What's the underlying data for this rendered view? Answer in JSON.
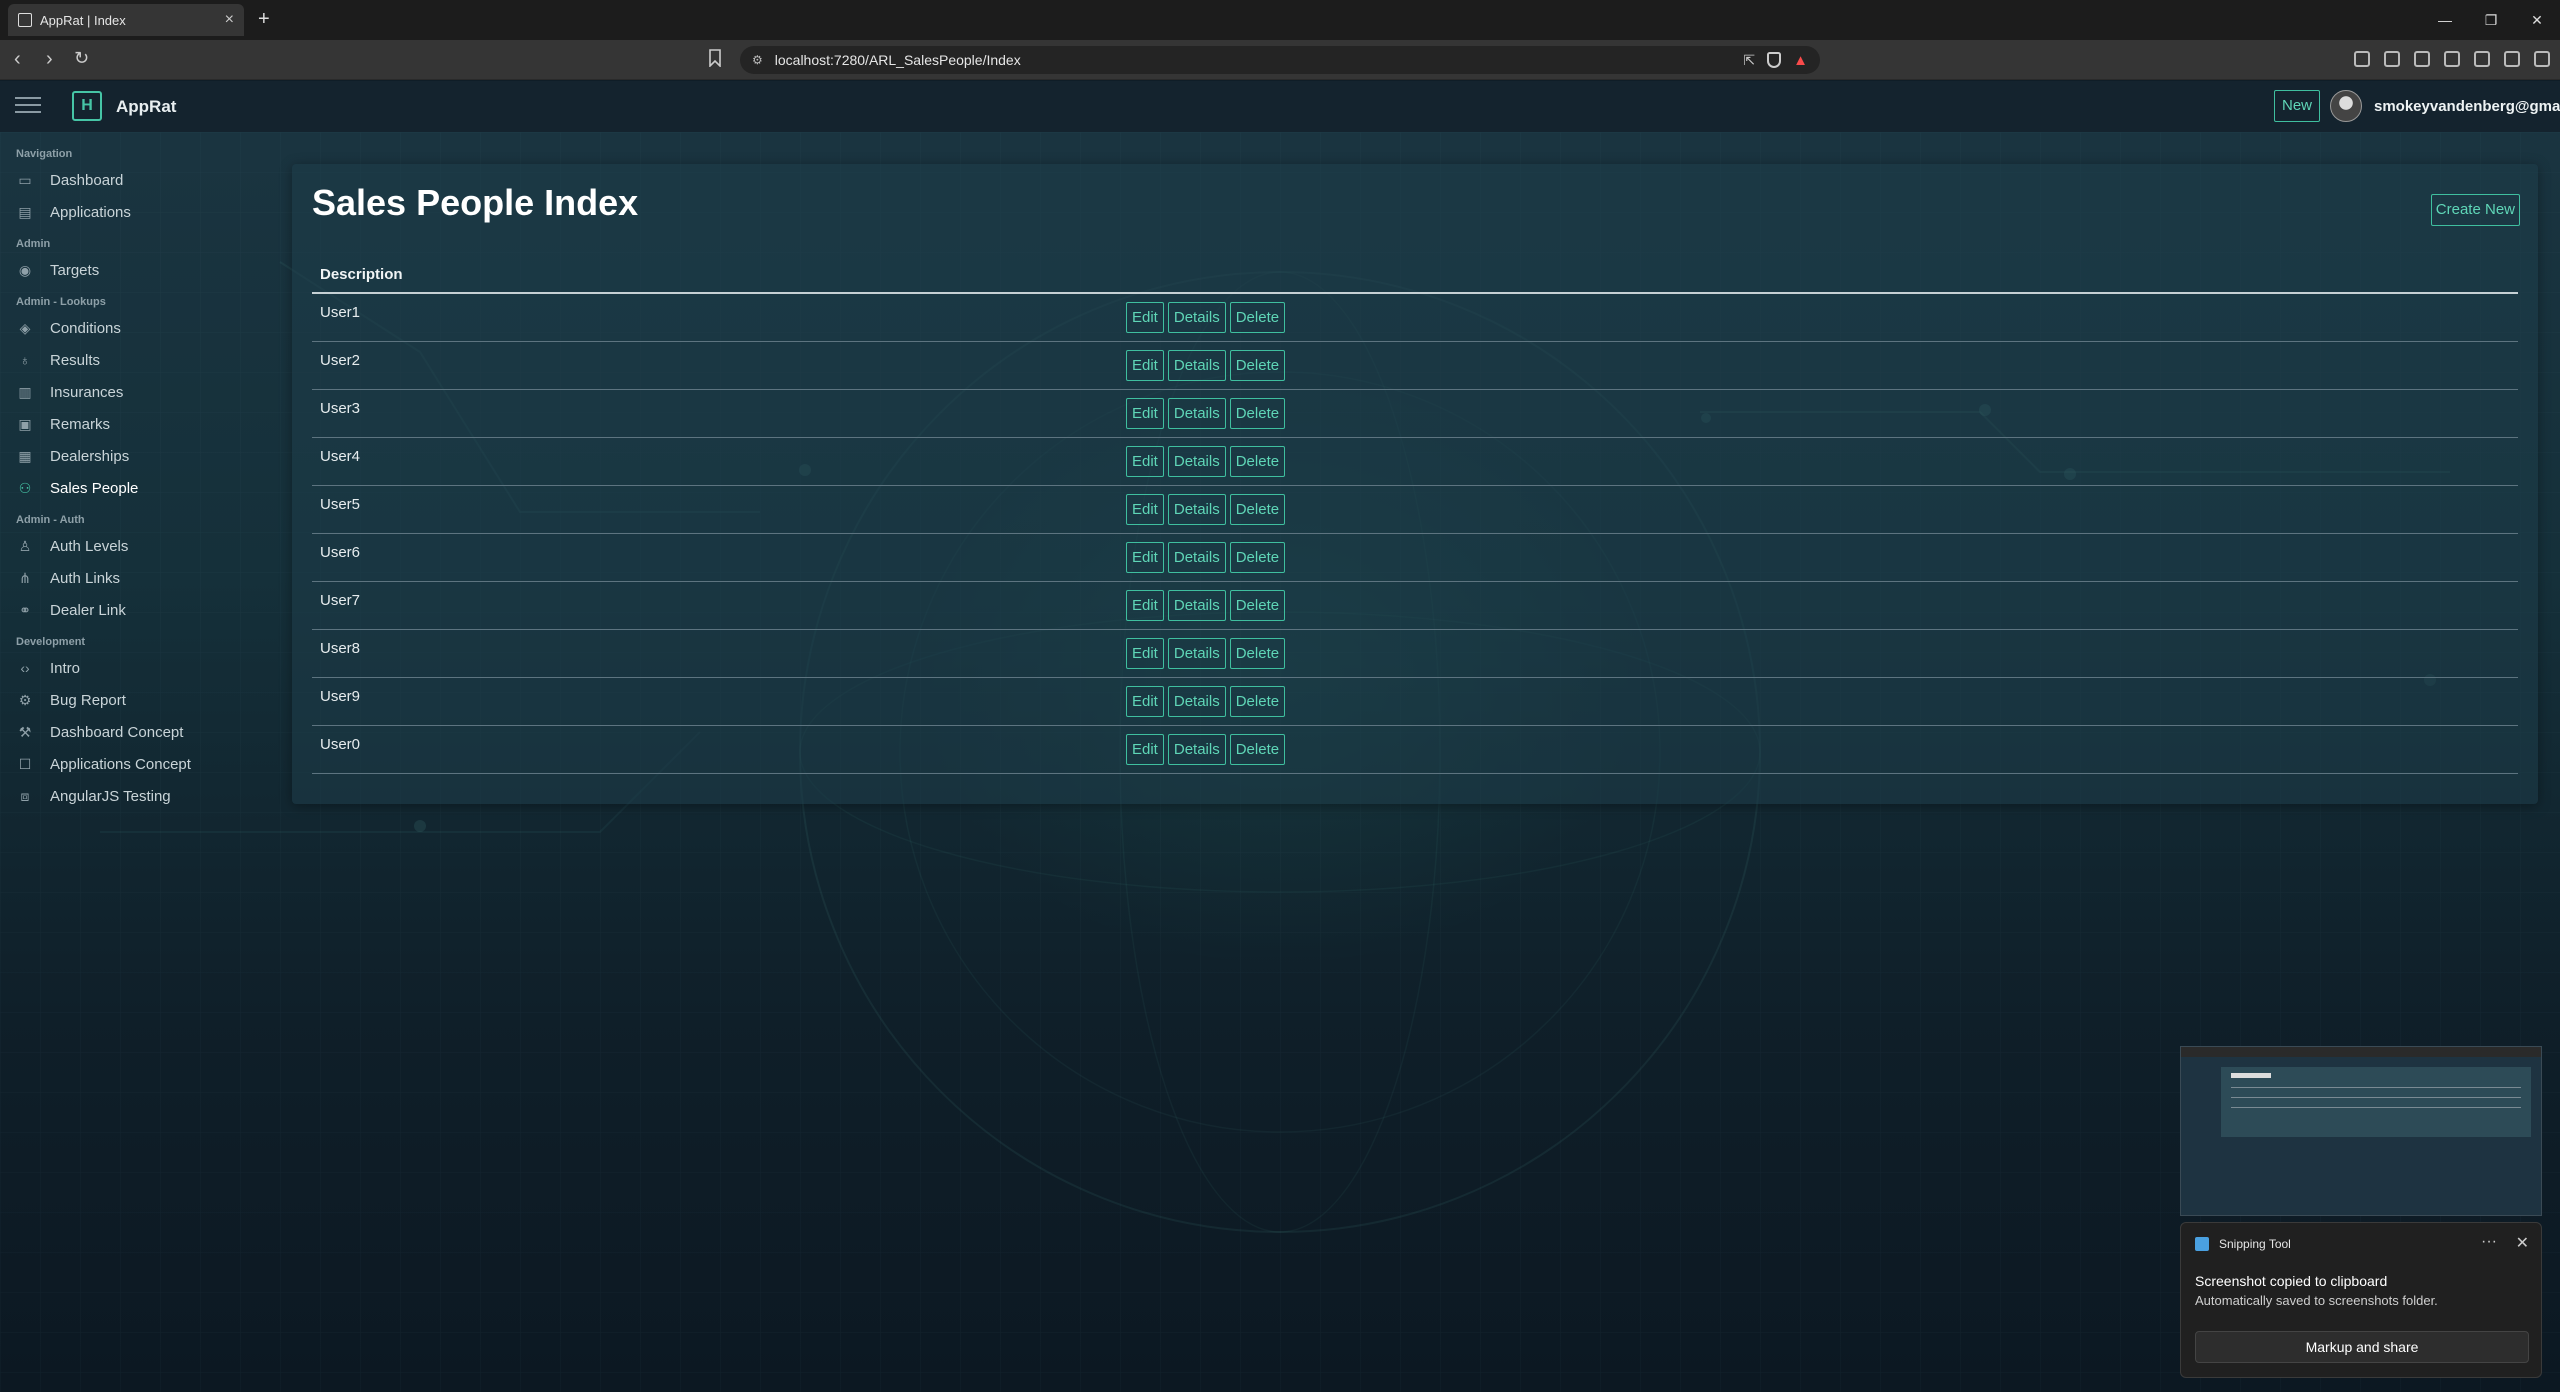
{
  "browser": {
    "tab_title": "AppRat | Index",
    "new_tab": "+",
    "url": "localhost:7280/ARL_SalesPeople/Index"
  },
  "header": {
    "app_name": "AppRat",
    "logo_letter": "H",
    "new_label": "New",
    "user_email": "smokeyvandenberg@gmail"
  },
  "sidebar": {
    "sections": [
      {
        "title": "Navigation",
        "items": [
          {
            "label": "Dashboard",
            "icon": "monitor-icon"
          },
          {
            "label": "Applications",
            "icon": "document-icon"
          }
        ]
      },
      {
        "title": "Admin",
        "items": [
          {
            "label": "Targets",
            "icon": "target-icon"
          }
        ]
      },
      {
        "title": "Admin - Lookups",
        "items": [
          {
            "label": "Conditions",
            "icon": "layers-icon"
          },
          {
            "label": "Results",
            "icon": "award-icon"
          },
          {
            "label": "Insurances",
            "icon": "building-icon"
          },
          {
            "label": "Remarks",
            "icon": "note-icon"
          },
          {
            "label": "Dealerships",
            "icon": "store-icon"
          },
          {
            "label": "Sales People",
            "icon": "users-icon",
            "active": true
          }
        ]
      },
      {
        "title": "Admin - Auth",
        "items": [
          {
            "label": "Auth Levels",
            "icon": "person-icon"
          },
          {
            "label": "Auth Links",
            "icon": "hierarchy-icon"
          },
          {
            "label": "Dealer Link",
            "icon": "link-icon"
          }
        ]
      },
      {
        "title": "Development",
        "items": [
          {
            "label": "Intro",
            "icon": "code-icon"
          },
          {
            "label": "Bug Report",
            "icon": "bug-icon"
          },
          {
            "label": "Dashboard Concept",
            "icon": "wrench-icon"
          },
          {
            "label": "Applications Concept",
            "icon": "window-icon"
          },
          {
            "label": "AngularJS Testing",
            "icon": "code-box-icon"
          }
        ]
      }
    ]
  },
  "main": {
    "title": "Sales People Index",
    "create_label": "Create New",
    "column_header": "Description",
    "rows": [
      "User1",
      "User2",
      "User3",
      "User4",
      "User5",
      "User6",
      "User7",
      "User8",
      "User9",
      "User0"
    ],
    "actions": {
      "edit": "Edit",
      "details": "Details",
      "delete": "Delete"
    }
  },
  "toast": {
    "app": "Snipping Tool",
    "more": "···",
    "close": "✕",
    "heading": "Screenshot copied to clipboard",
    "subtext": "Automatically saved to screenshots folder.",
    "button": "Markup and share"
  },
  "colors": {
    "accent": "#46c5a6",
    "background": "#0f1d27",
    "card": "#1e3c48"
  }
}
